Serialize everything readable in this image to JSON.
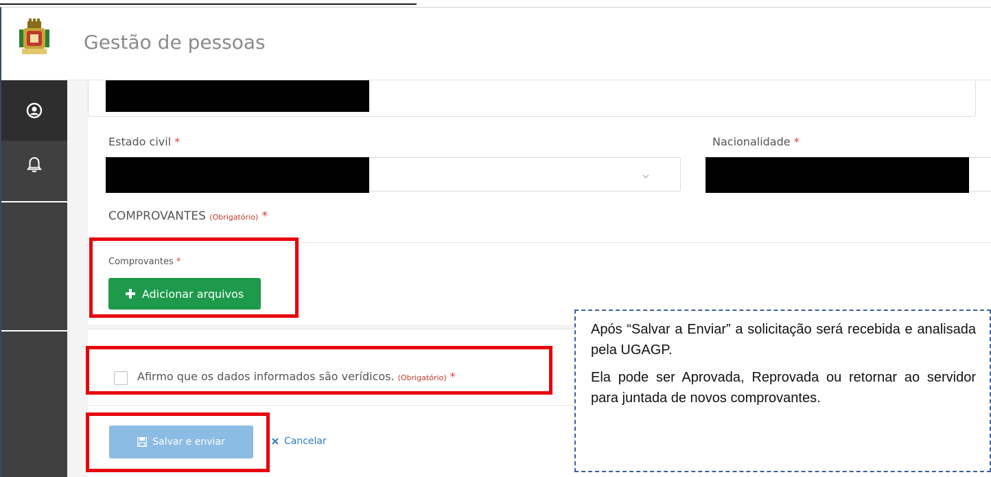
{
  "app": {
    "title": "Gestão de pessoas"
  },
  "sidebar": {
    "items": [
      {
        "icon": "user-circle-icon"
      },
      {
        "icon": "bell-icon"
      }
    ]
  },
  "form": {
    "estado_civil": {
      "label": "Estado civil",
      "required_mark": "*"
    },
    "nacionalidade": {
      "label": "Nacionalidade",
      "required_mark": "*"
    },
    "comprovantes_section": {
      "title": "COMPROVANTES",
      "obrigatorio": "(Obrigatório)",
      "required_mark": "*"
    },
    "comprovantes_field": {
      "label": "Comprovantes",
      "required_mark": "*",
      "add_button": "Adicionar arquivos"
    },
    "declaration": {
      "text": "Afirmo que os dados informados são verídicos.",
      "obrigatorio": "(Obrigatório)",
      "required_mark": "*",
      "checked": false
    },
    "actions": {
      "save_label": "Salvar e enviar",
      "cancel_label": "Cancelar"
    }
  },
  "note": {
    "paragraph1": "Após “Salvar a Enviar” a solicitação será recebida e analisada pela UGAGP.",
    "paragraph2": "Ela pode ser Aprovada, Reprovada ou retornar ao servidor para juntada de novos comprovantes."
  },
  "colors": {
    "sidebar": "#404040",
    "add_button": "#1d9a4b",
    "save_button": "#8cbbe3",
    "highlight": "#e8000b",
    "note_border": "#3b5e9e"
  }
}
